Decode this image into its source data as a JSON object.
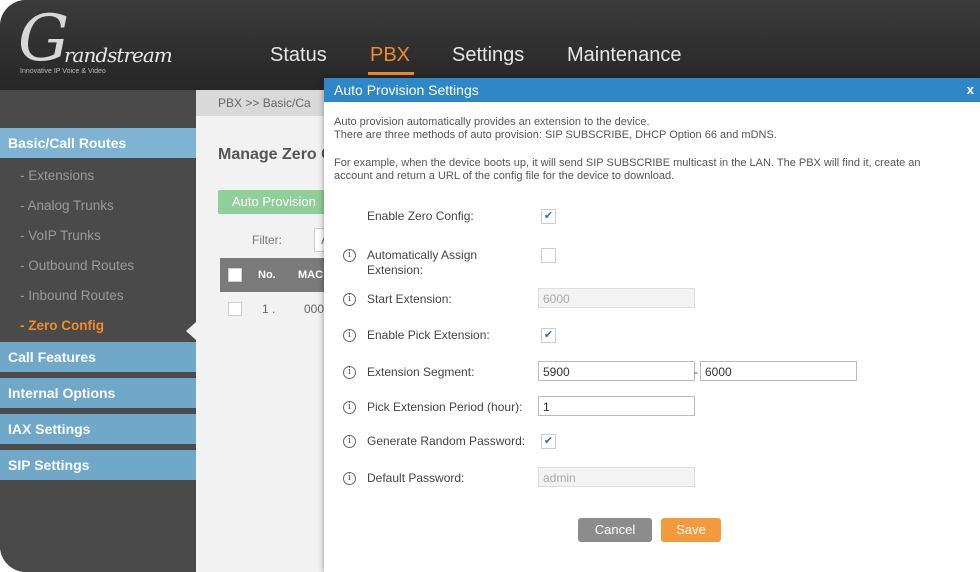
{
  "brand": {
    "logo_letter": "G",
    "logo_text": "randstream",
    "tagline": "Innovative IP Voice & Video"
  },
  "nav": {
    "items": [
      "Status",
      "PBX",
      "Settings",
      "Maintenance"
    ],
    "active": "PBX"
  },
  "sidebar": {
    "section_basic": "Basic/Call Routes",
    "items": [
      "- Extensions",
      "- Analog Trunks",
      "- VoIP Trunks",
      "- Outbound Routes",
      "- Inbound Routes",
      "- Zero Config"
    ],
    "active_item": "- Zero Config",
    "sections": [
      "Call Features",
      "Internal Options",
      "IAX Settings",
      "SIP Settings"
    ]
  },
  "content": {
    "breadcrumb": "PBX >> Basic/Ca",
    "title": "Manage Zero C",
    "auto_provision_button": "Auto Provision",
    "filter_label": "Filter:",
    "filter_value": "A",
    "table_headers": [
      "No.",
      "MAC"
    ],
    "rows": [
      {
        "no": "1 .",
        "mac": "000"
      }
    ]
  },
  "modal": {
    "title": "Auto Provision Settings",
    "close": "x",
    "desc_line1": "Auto provision automatically provides an extension to the device.",
    "desc_line2": "There are three methods of auto provision: SIP SUBSCRIBE, DHCP Option 66 and mDNS.",
    "desc_line3": "For example, when the device boots up, it will send SIP SUBSCRIBE multicast in the LAN. The PBX will find it, create an",
    "desc_line4": "account and return a URL of the config file for the device to download.",
    "fields": {
      "enable_zero_config": {
        "label": "Enable Zero Config:",
        "checked": true
      },
      "auto_assign": {
        "label1": "Automatically Assign",
        "label2": "Extension:",
        "checked": false
      },
      "start_extension": {
        "label": "Start Extension:",
        "value": "6000"
      },
      "enable_pick": {
        "label": "Enable Pick Extension:",
        "checked": true
      },
      "ext_segment": {
        "label": "Extension Segment:",
        "from": "5900",
        "separator": "-",
        "to": "6000"
      },
      "pick_period": {
        "label": "Pick Extension Period (hour):",
        "value": "1"
      },
      "gen_random_pw": {
        "label": "Generate Random Password:",
        "checked": true
      },
      "default_password": {
        "label": "Default Password:",
        "value": "admin"
      }
    },
    "check_mark": "✔",
    "info_glyph": "i",
    "cancel_label": "Cancel",
    "save_label": "Save"
  },
  "colors": {
    "accent": "#f08c2a",
    "header_blue": "#2f87c8",
    "sidebar_head": "#6fa8c9",
    "save": "#f29a3c"
  }
}
